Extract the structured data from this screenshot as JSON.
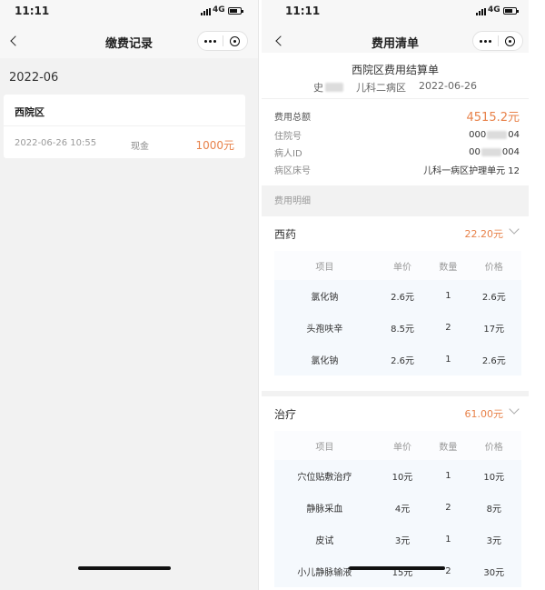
{
  "left": {
    "status": {
      "time": "11:11",
      "network": "4G"
    },
    "nav": {
      "title": "缴费记录"
    },
    "month": "2022-06",
    "card": {
      "hospital": "西院区",
      "datetime": "2022-06-26 10:55",
      "method": "现金",
      "amount": "1000元"
    }
  },
  "right": {
    "status": {
      "time": "11:11",
      "network": "4G"
    },
    "nav": {
      "title": "费用清单"
    },
    "summary": {
      "title": "西院区费用结算单",
      "patient_prefix": "史",
      "patient_suffix": "",
      "ward": "儿科二病区",
      "date": "2022-06-26",
      "total_label": "费用总额",
      "total_value": "4515.2元",
      "inpatient_label": "住院号",
      "inpatient_prefix": "000",
      "inpatient_suffix": "04",
      "patient_id_label": "病人ID",
      "patient_id_prefix": "00",
      "patient_id_suffix": "004",
      "bed_label": "病区床号",
      "bed_value": "儿科一病区护理单元 12"
    },
    "detail_label": "费用明细",
    "table_headers": {
      "item": "项目",
      "unit_price": "单价",
      "qty": "数量",
      "price": "价格"
    },
    "sections": [
      {
        "name": "西药",
        "total": "22.20元",
        "rows": [
          {
            "item": "氯化钠",
            "unit_price": "2.6元",
            "qty": "1",
            "price": "2.6元"
          },
          {
            "item": "头孢呋辛",
            "unit_price": "8.5元",
            "qty": "2",
            "price": "17元"
          },
          {
            "item": "氯化钠",
            "unit_price": "2.6元",
            "qty": "1",
            "price": "2.6元"
          }
        ]
      },
      {
        "name": "治疗",
        "total": "61.00元",
        "rows": [
          {
            "item": "穴位贴敷治疗",
            "unit_price": "10元",
            "qty": "1",
            "price": "10元"
          },
          {
            "item": "静脉采血",
            "unit_price": "4元",
            "qty": "2",
            "price": "8元"
          },
          {
            "item": "皮试",
            "unit_price": "3元",
            "qty": "1",
            "price": "3元"
          },
          {
            "item": "小儿静脉输液",
            "unit_price": "15元",
            "qty": "2",
            "price": "30元"
          }
        ]
      }
    ]
  },
  "colors": {
    "accent": "#e8824a",
    "background": "#f2f2f2",
    "table_bg": "#f5f9fd"
  },
  "icons": [
    "back-chevron-icon",
    "more-dots-icon",
    "close-target-icon",
    "signal-icon",
    "battery-icon",
    "chevron-down-icon"
  ]
}
